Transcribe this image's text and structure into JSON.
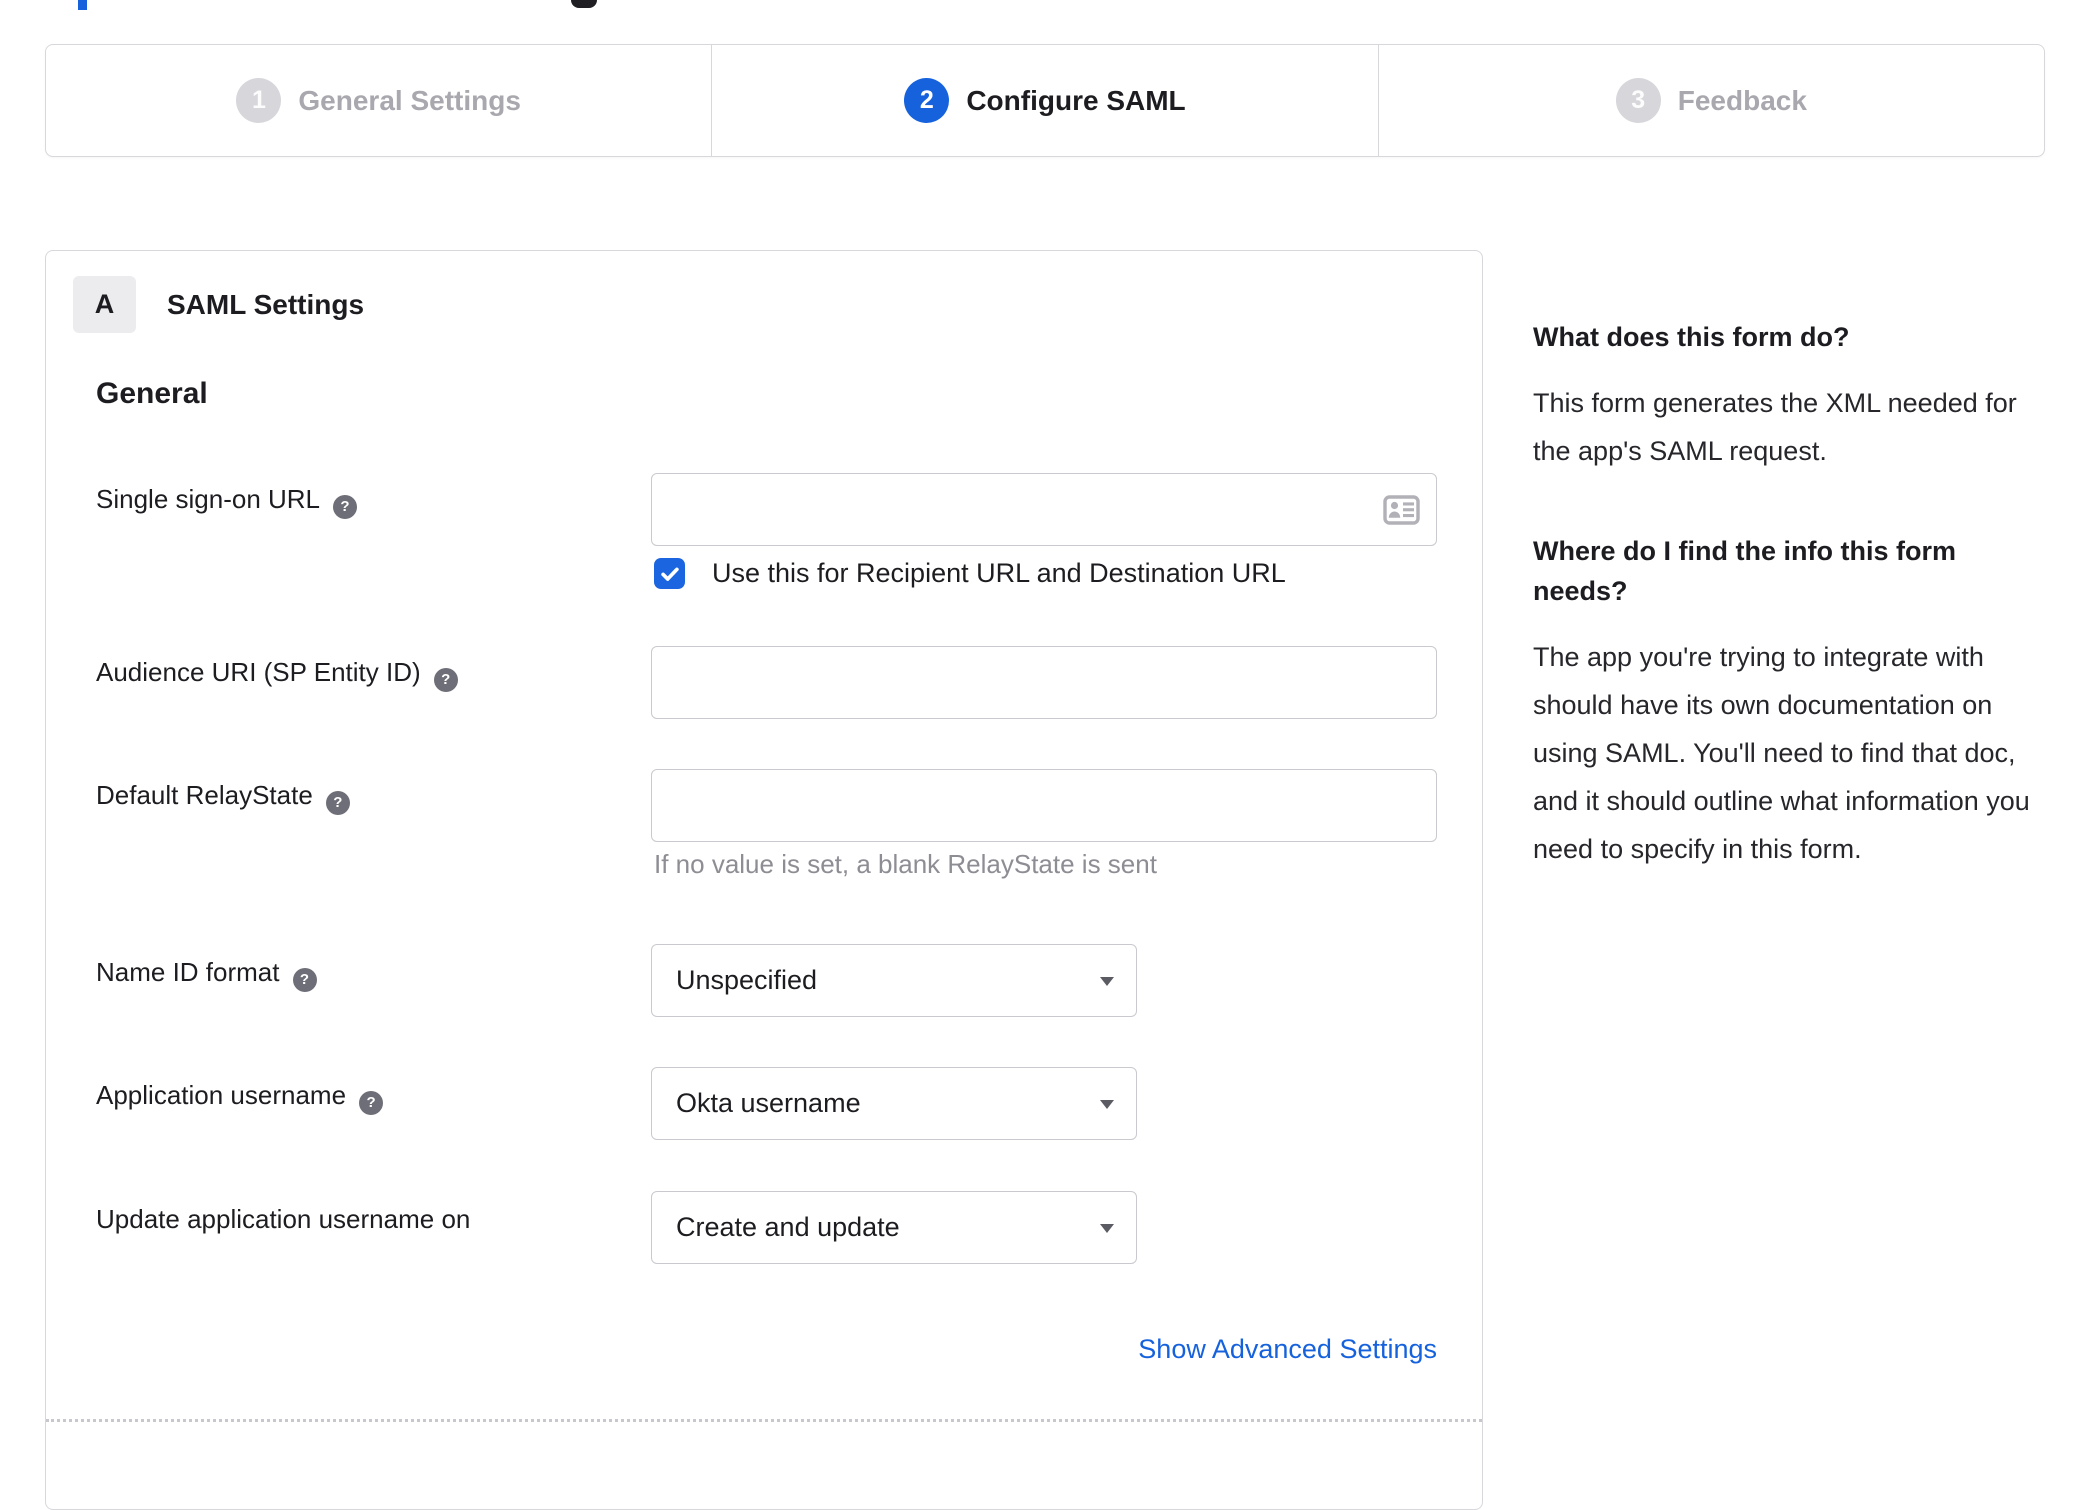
{
  "page": {
    "background": "#ffffff",
    "text_color": "#1d1d21",
    "accent_color": "#1662dd",
    "border_color": "#d7d7dc",
    "input_border_color": "#c9c9cf",
    "inactive_step_circle_color": "#d6d6db",
    "inactive_step_label_color": "#a8a8ae",
    "helper_text_color": "#8d8d94",
    "help_icon_color": "#6e6e78",
    "link_color": "#1662dd"
  },
  "icons": {
    "help_glyph": "?",
    "help_name": "question-mark-icon",
    "input_trailing_name": "contact-card-icon",
    "select_caret_name": "caret-down-icon",
    "checkbox_name": "checkmark-icon"
  },
  "stepper": {
    "steps": [
      {
        "number": "1",
        "label": "General Settings",
        "state": "inactive"
      },
      {
        "number": "2",
        "label": "Configure SAML",
        "state": "active"
      },
      {
        "number": "3",
        "label": "Feedback",
        "state": "inactive"
      }
    ]
  },
  "form": {
    "section_badge": "A",
    "section_title": "SAML Settings",
    "group_title": "General",
    "fields": [
      {
        "label": "Single sign-on URL",
        "type": "text",
        "value": "",
        "has_help": true,
        "trailing_icon": "contact-card-icon",
        "checkbox": {
          "checked": true,
          "label": "Use this for Recipient URL and Destination URL"
        }
      },
      {
        "label": "Audience URI (SP Entity ID)",
        "type": "text",
        "value": "",
        "has_help": true
      },
      {
        "label": "Default RelayState",
        "type": "text",
        "value": "",
        "has_help": true,
        "helper": "If no value is set, a blank RelayState is sent"
      },
      {
        "label": "Name ID format",
        "type": "select",
        "value": "Unspecified",
        "has_help": true
      },
      {
        "label": "Application username",
        "type": "select",
        "value": "Okta username",
        "has_help": true
      },
      {
        "label": "Update application username on",
        "type": "select",
        "value": "Create and update",
        "has_help": false
      }
    ],
    "advanced_link_label": "Show Advanced Settings"
  },
  "sidebar": {
    "sections": [
      {
        "heading": "What does this form do?",
        "body": "This form generates the XML needed for the app's SAML request."
      },
      {
        "heading": "Where do I find the info this form needs?",
        "body": "The app you're trying to integrate with should have its own documentation on using SAML. You'll need to find that doc, and it should outline what information you need to specify in this form."
      }
    ]
  }
}
